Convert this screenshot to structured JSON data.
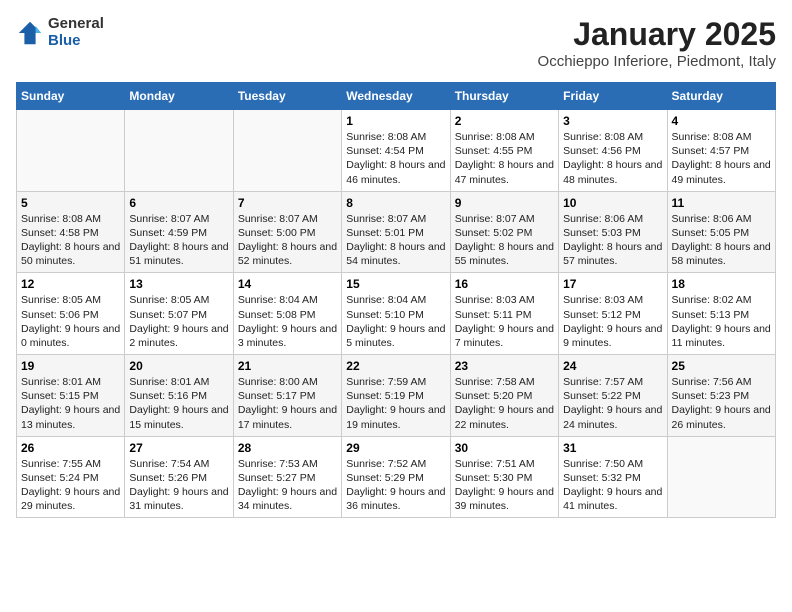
{
  "header": {
    "logo_general": "General",
    "logo_blue": "Blue",
    "title": "January 2025",
    "subtitle": "Occhieppo Inferiore, Piedmont, Italy"
  },
  "days_of_week": [
    "Sunday",
    "Monday",
    "Tuesday",
    "Wednesday",
    "Thursday",
    "Friday",
    "Saturday"
  ],
  "weeks": [
    [
      {
        "day": "",
        "info": ""
      },
      {
        "day": "",
        "info": ""
      },
      {
        "day": "",
        "info": ""
      },
      {
        "day": "1",
        "info": "Sunrise: 8:08 AM\nSunset: 4:54 PM\nDaylight: 8 hours and 46 minutes."
      },
      {
        "day": "2",
        "info": "Sunrise: 8:08 AM\nSunset: 4:55 PM\nDaylight: 8 hours and 47 minutes."
      },
      {
        "day": "3",
        "info": "Sunrise: 8:08 AM\nSunset: 4:56 PM\nDaylight: 8 hours and 48 minutes."
      },
      {
        "day": "4",
        "info": "Sunrise: 8:08 AM\nSunset: 4:57 PM\nDaylight: 8 hours and 49 minutes."
      }
    ],
    [
      {
        "day": "5",
        "info": "Sunrise: 8:08 AM\nSunset: 4:58 PM\nDaylight: 8 hours and 50 minutes."
      },
      {
        "day": "6",
        "info": "Sunrise: 8:07 AM\nSunset: 4:59 PM\nDaylight: 8 hours and 51 minutes."
      },
      {
        "day": "7",
        "info": "Sunrise: 8:07 AM\nSunset: 5:00 PM\nDaylight: 8 hours and 52 minutes."
      },
      {
        "day": "8",
        "info": "Sunrise: 8:07 AM\nSunset: 5:01 PM\nDaylight: 8 hours and 54 minutes."
      },
      {
        "day": "9",
        "info": "Sunrise: 8:07 AM\nSunset: 5:02 PM\nDaylight: 8 hours and 55 minutes."
      },
      {
        "day": "10",
        "info": "Sunrise: 8:06 AM\nSunset: 5:03 PM\nDaylight: 8 hours and 57 minutes."
      },
      {
        "day": "11",
        "info": "Sunrise: 8:06 AM\nSunset: 5:05 PM\nDaylight: 8 hours and 58 minutes."
      }
    ],
    [
      {
        "day": "12",
        "info": "Sunrise: 8:05 AM\nSunset: 5:06 PM\nDaylight: 9 hours and 0 minutes."
      },
      {
        "day": "13",
        "info": "Sunrise: 8:05 AM\nSunset: 5:07 PM\nDaylight: 9 hours and 2 minutes."
      },
      {
        "day": "14",
        "info": "Sunrise: 8:04 AM\nSunset: 5:08 PM\nDaylight: 9 hours and 3 minutes."
      },
      {
        "day": "15",
        "info": "Sunrise: 8:04 AM\nSunset: 5:10 PM\nDaylight: 9 hours and 5 minutes."
      },
      {
        "day": "16",
        "info": "Sunrise: 8:03 AM\nSunset: 5:11 PM\nDaylight: 9 hours and 7 minutes."
      },
      {
        "day": "17",
        "info": "Sunrise: 8:03 AM\nSunset: 5:12 PM\nDaylight: 9 hours and 9 minutes."
      },
      {
        "day": "18",
        "info": "Sunrise: 8:02 AM\nSunset: 5:13 PM\nDaylight: 9 hours and 11 minutes."
      }
    ],
    [
      {
        "day": "19",
        "info": "Sunrise: 8:01 AM\nSunset: 5:15 PM\nDaylight: 9 hours and 13 minutes."
      },
      {
        "day": "20",
        "info": "Sunrise: 8:01 AM\nSunset: 5:16 PM\nDaylight: 9 hours and 15 minutes."
      },
      {
        "day": "21",
        "info": "Sunrise: 8:00 AM\nSunset: 5:17 PM\nDaylight: 9 hours and 17 minutes."
      },
      {
        "day": "22",
        "info": "Sunrise: 7:59 AM\nSunset: 5:19 PM\nDaylight: 9 hours and 19 minutes."
      },
      {
        "day": "23",
        "info": "Sunrise: 7:58 AM\nSunset: 5:20 PM\nDaylight: 9 hours and 22 minutes."
      },
      {
        "day": "24",
        "info": "Sunrise: 7:57 AM\nSunset: 5:22 PM\nDaylight: 9 hours and 24 minutes."
      },
      {
        "day": "25",
        "info": "Sunrise: 7:56 AM\nSunset: 5:23 PM\nDaylight: 9 hours and 26 minutes."
      }
    ],
    [
      {
        "day": "26",
        "info": "Sunrise: 7:55 AM\nSunset: 5:24 PM\nDaylight: 9 hours and 29 minutes."
      },
      {
        "day": "27",
        "info": "Sunrise: 7:54 AM\nSunset: 5:26 PM\nDaylight: 9 hours and 31 minutes."
      },
      {
        "day": "28",
        "info": "Sunrise: 7:53 AM\nSunset: 5:27 PM\nDaylight: 9 hours and 34 minutes."
      },
      {
        "day": "29",
        "info": "Sunrise: 7:52 AM\nSunset: 5:29 PM\nDaylight: 9 hours and 36 minutes."
      },
      {
        "day": "30",
        "info": "Sunrise: 7:51 AM\nSunset: 5:30 PM\nDaylight: 9 hours and 39 minutes."
      },
      {
        "day": "31",
        "info": "Sunrise: 7:50 AM\nSunset: 5:32 PM\nDaylight: 9 hours and 41 minutes."
      },
      {
        "day": "",
        "info": ""
      }
    ]
  ]
}
